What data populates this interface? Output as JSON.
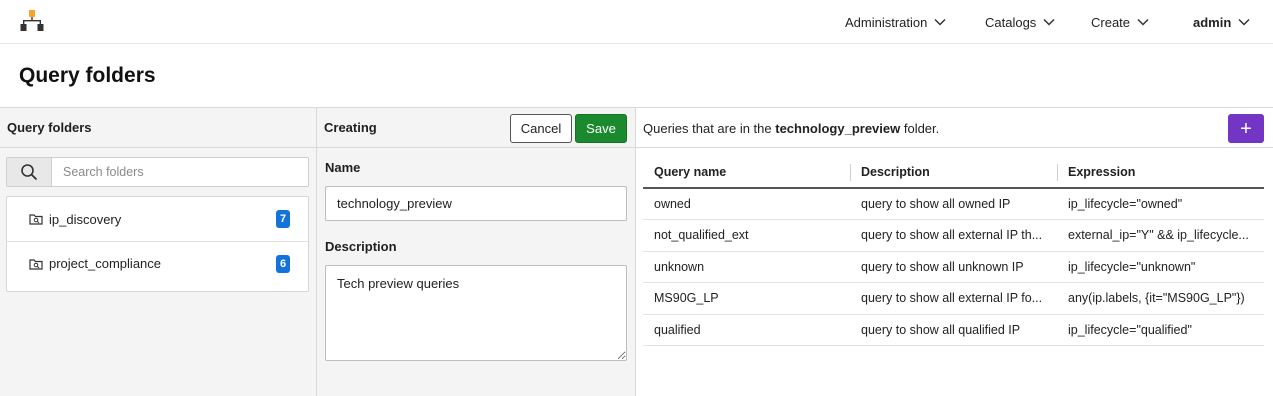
{
  "topbar": {
    "nav": [
      {
        "label": "Administration"
      },
      {
        "label": "Catalogs"
      },
      {
        "label": "Create"
      },
      {
        "label": "admin"
      }
    ]
  },
  "page": {
    "title": "Query folders"
  },
  "folders_panel": {
    "title": "Query folders",
    "search_placeholder": "Search folders",
    "items": [
      {
        "name": "ip_discovery",
        "count": "7"
      },
      {
        "name": "project_compliance",
        "count": "6"
      }
    ]
  },
  "editor": {
    "title": "Creating",
    "cancel_label": "Cancel",
    "save_label": "Save",
    "name_label": "Name",
    "name_value": "technology_preview",
    "description_label": "Description",
    "description_value": "Tech preview queries"
  },
  "queries": {
    "intro_prefix": "Queries that are in the ",
    "folder_name": "technology_preview",
    "intro_suffix": " folder.",
    "add_label": "+",
    "columns": [
      "Query name",
      "Description",
      "Expression"
    ],
    "rows": [
      {
        "name": "owned",
        "description": "query to show all owned IP",
        "expression": "ip_lifecycle=\"owned\""
      },
      {
        "name": "not_qualified_ext",
        "description": "query to show all external IP th...",
        "expression": "external_ip=\"Y\" && ip_lifecycle..."
      },
      {
        "name": "unknown",
        "description": "query to show all unknown IP",
        "expression": "ip_lifecycle=\"unknown\""
      },
      {
        "name": "MS90G_LP",
        "description": "query to show all external IP fo...",
        "expression": "any(ip.labels, {it=\"MS90G_LP\"})"
      },
      {
        "name": "qualified",
        "description": "query to show all qualified IP",
        "expression": "ip_lifecycle=\"qualified\""
      }
    ]
  },
  "colors": {
    "save": "#1b8a2e",
    "add": "#7335c4",
    "badge": "#1473d8",
    "logo": "#f5a623"
  },
  "icons": [
    "app-logo-icon",
    "chevron-down-icon",
    "search-icon",
    "folder-icon",
    "plus-icon"
  ]
}
